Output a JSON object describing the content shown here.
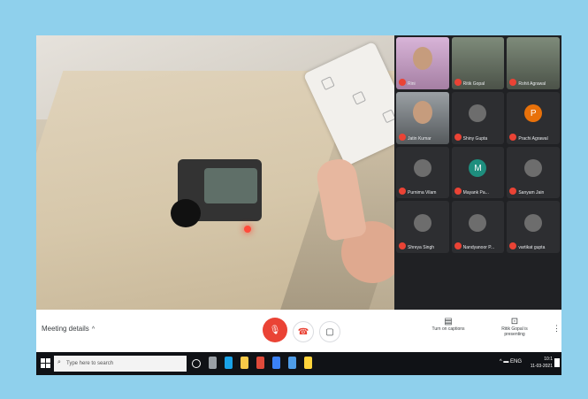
{
  "presenter": {
    "subject": "robot-demo-video"
  },
  "participants": [
    {
      "name": "Rini",
      "kind": "girl"
    },
    {
      "name": "Ritik Gopal",
      "kind": "video"
    },
    {
      "name": "Rohit Agrawal",
      "kind": "video"
    },
    {
      "name": "Jatin Kumar",
      "kind": "boy"
    },
    {
      "name": "Shiny Gupta",
      "kind": "avatar",
      "initial": ""
    },
    {
      "name": "Prachi Agrawal",
      "kind": "avatar",
      "initial": "P"
    },
    {
      "name": "Purnima Vilam",
      "kind": "avatar",
      "initial": ""
    },
    {
      "name": "Mayank Pa...",
      "kind": "avatar",
      "initial": "M"
    },
    {
      "name": "Sanyam Jain",
      "kind": "avatar",
      "initial": ""
    },
    {
      "name": "Shreya Singh",
      "kind": "avatar",
      "initial": ""
    },
    {
      "name": "Nandyanoor P...",
      "kind": "avatar",
      "initial": ""
    },
    {
      "name": "vartikat gupta",
      "kind": "avatar",
      "initial": ""
    },
    {
      "name": "",
      "kind": "empty"
    },
    {
      "name": "",
      "kind": "empty"
    },
    {
      "name": "",
      "kind": "empty"
    }
  ],
  "controls": {
    "meeting_details": "Meeting details",
    "captions_label": "Turn on captions",
    "present_label": "Ritik Gopal is presenting"
  },
  "taskbar": {
    "search_placeholder": "Type here to search",
    "time": "10:1",
    "date": "11-03-2021"
  }
}
